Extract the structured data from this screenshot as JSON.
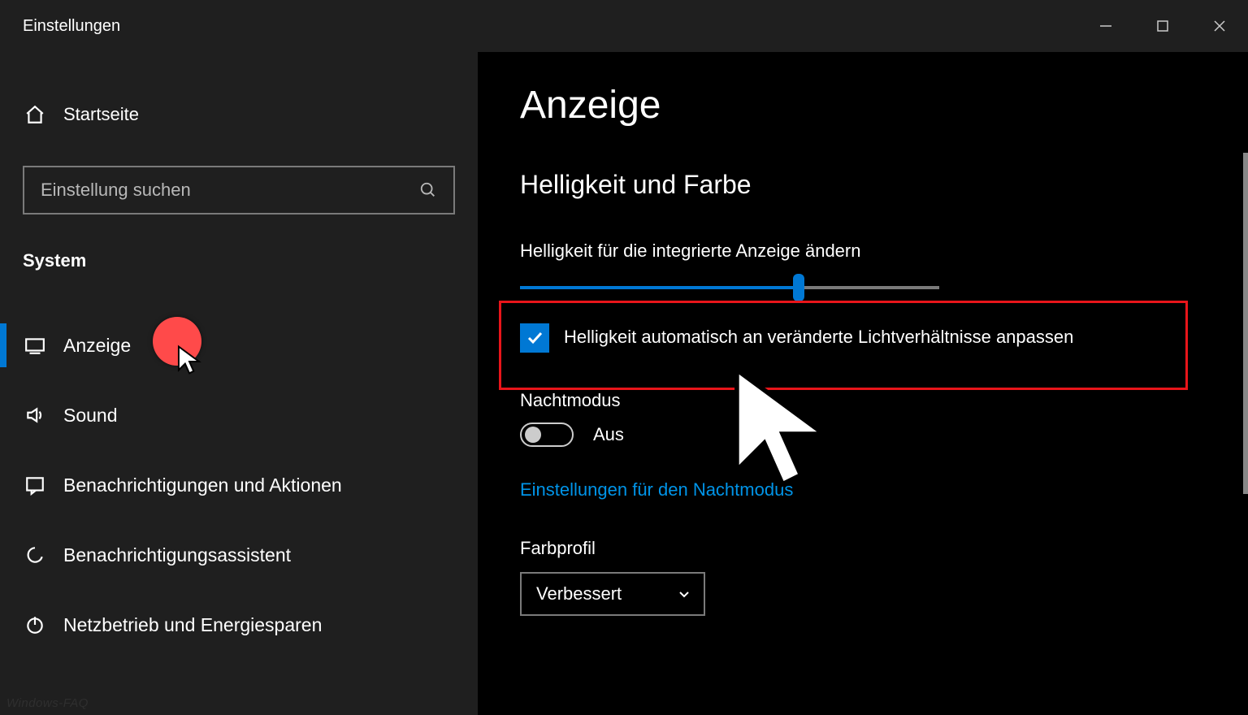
{
  "window": {
    "title": "Einstellungen"
  },
  "sidebar": {
    "home_label": "Startseite",
    "search_placeholder": "Einstellung suchen",
    "section_label": "System",
    "items": [
      {
        "label": "Anzeige",
        "active": true
      },
      {
        "label": "Sound"
      },
      {
        "label": "Benachrichtigungen und Aktionen"
      },
      {
        "label": "Benachrichtigungsassistent"
      },
      {
        "label": "Netzbetrieb und Energiesparen"
      }
    ]
  },
  "main": {
    "page_title": "Anzeige",
    "section_title": "Helligkeit und Farbe",
    "brightness_label": "Helligkeit für die integrierte Anzeige ändern",
    "auto_brightness_checkbox": {
      "checked": true,
      "label": "Helligkeit automatisch an veränderte Lichtverhältnisse anpassen"
    },
    "nightmode_label": "Nachtmodus",
    "nightmode_state": "Aus",
    "nightmode_link": "Einstellungen für den Nachtmodus",
    "colorprofile_label": "Farbprofil",
    "colorprofile_value": "Verbessert"
  },
  "watermark": "Windows-FAQ"
}
